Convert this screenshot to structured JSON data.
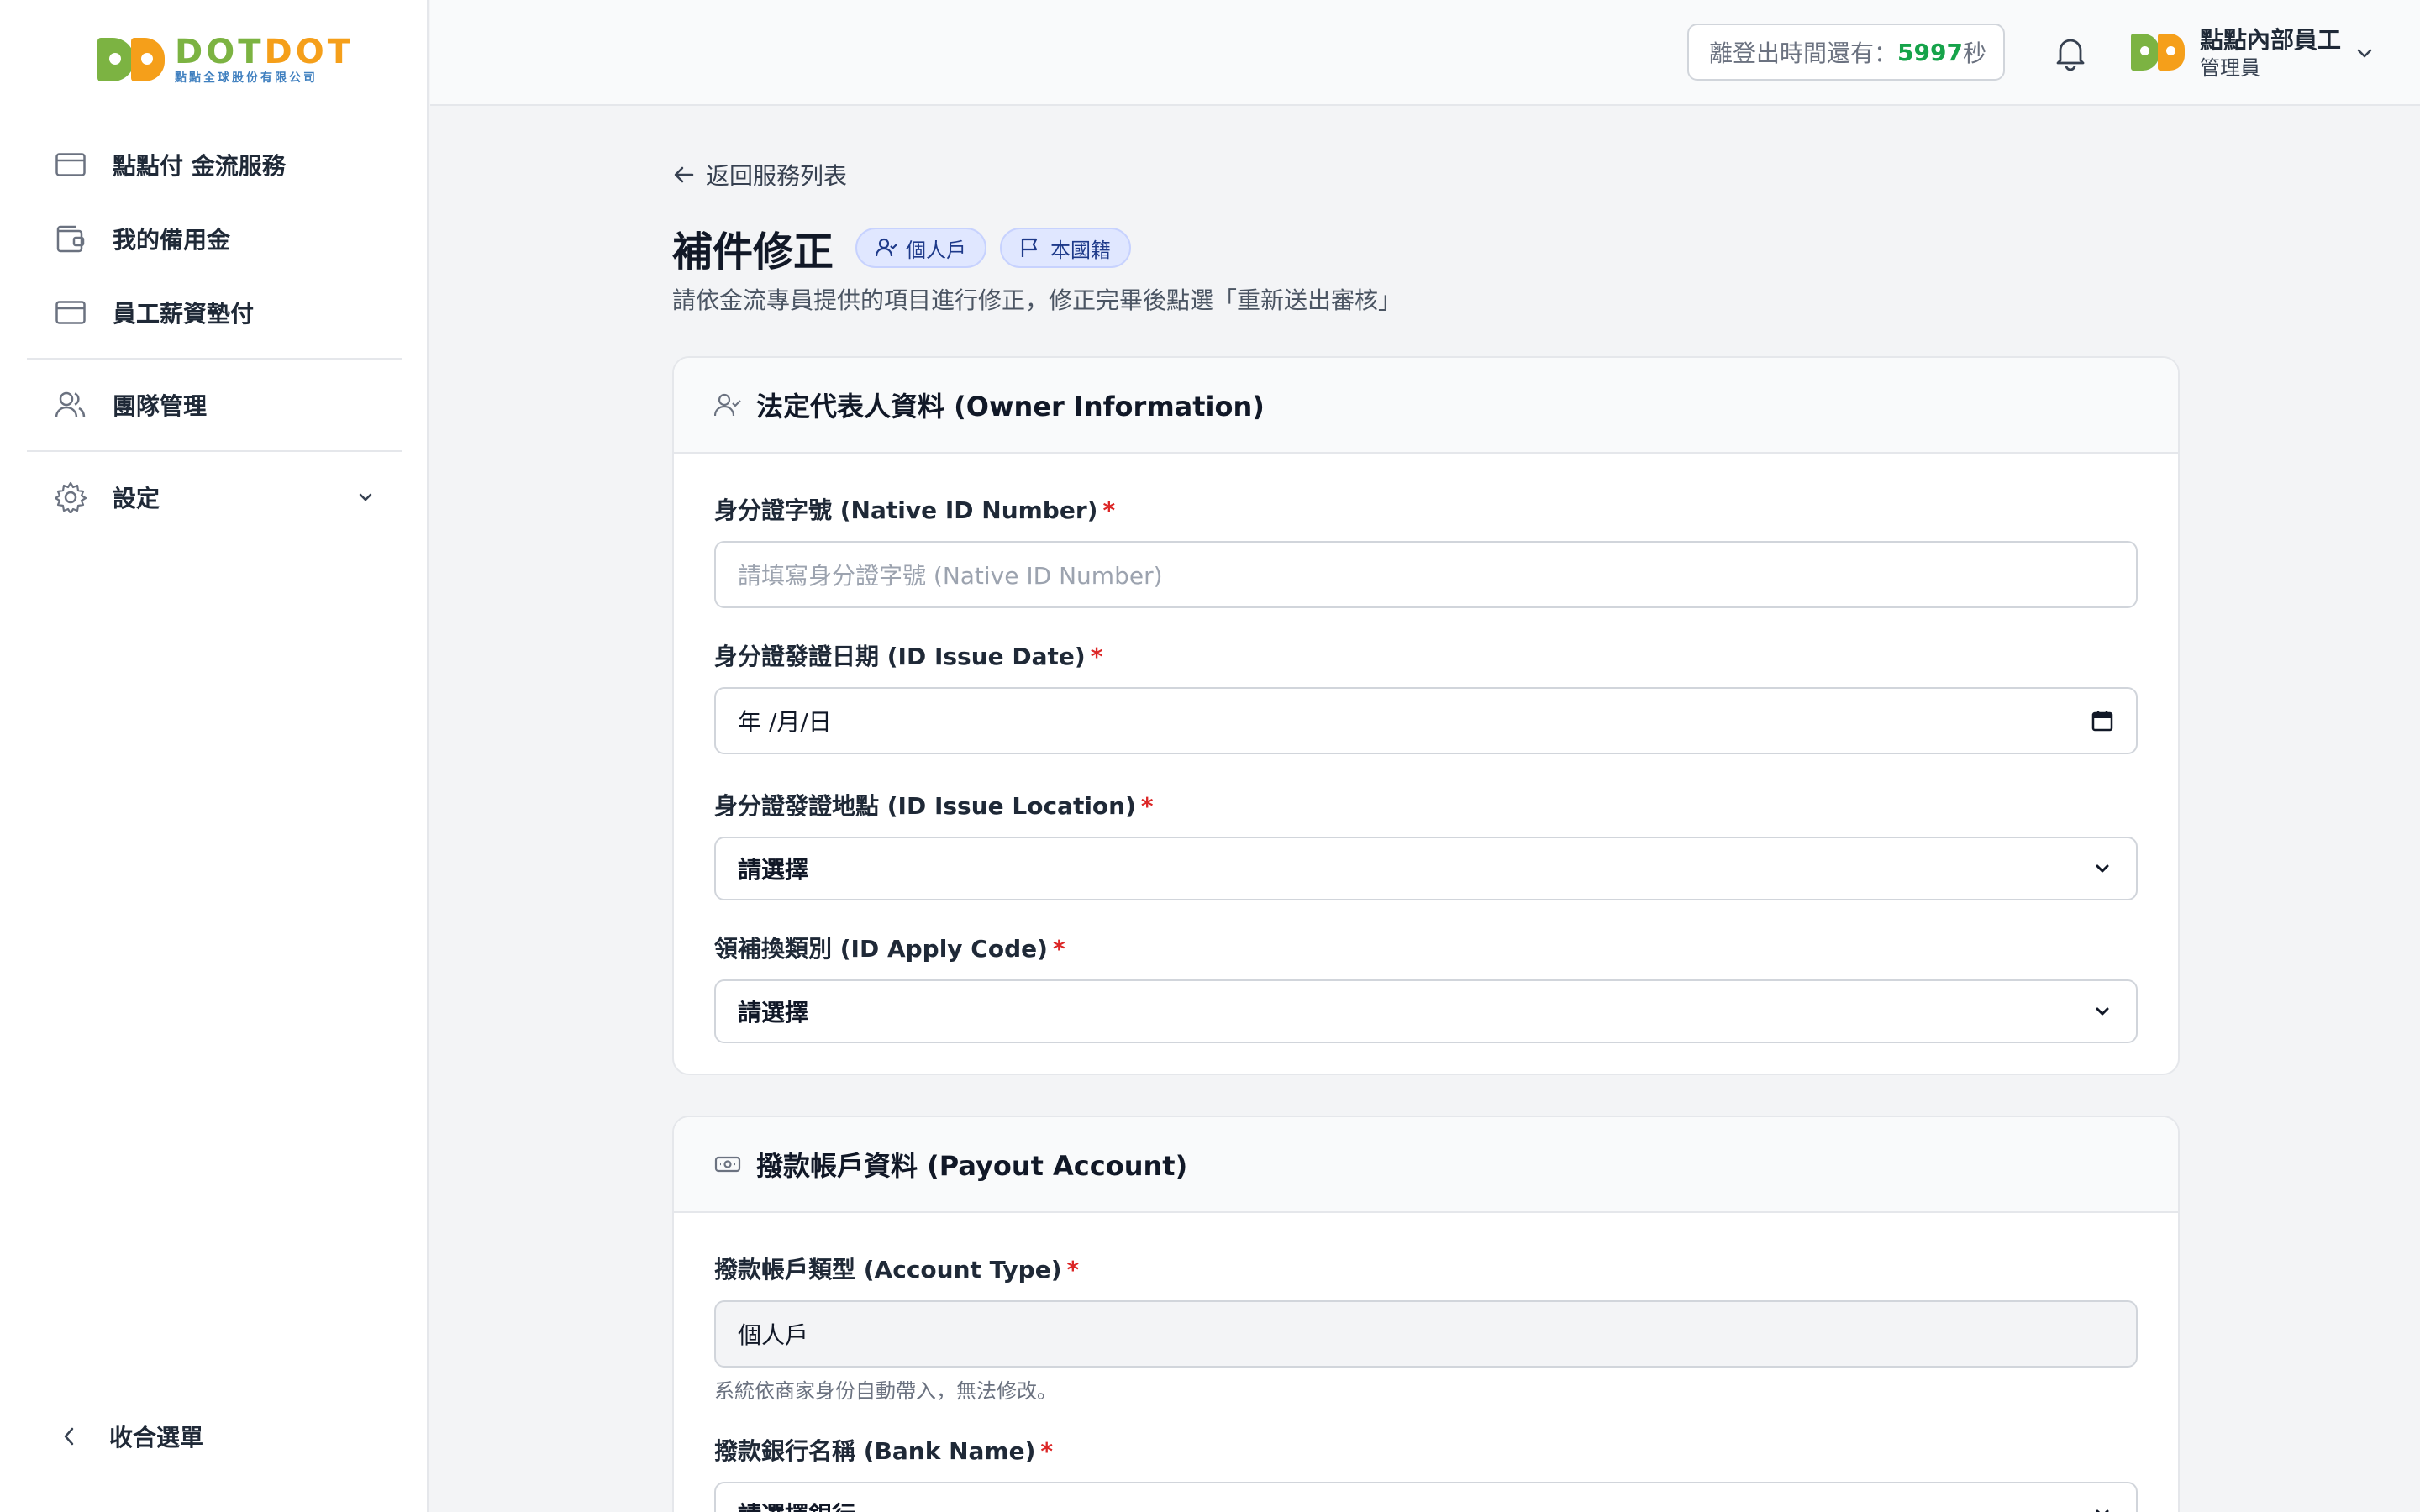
{
  "brand": {
    "name_part1": "DOT",
    "name_part2": "DOT",
    "subtitle": "點點全球股份有限公司"
  },
  "sidebar": {
    "items": [
      {
        "label": "點點付 金流服務",
        "icon": "credit-card-icon"
      },
      {
        "label": "我的備用金",
        "icon": "wallet-icon"
      },
      {
        "label": "員工薪資墊付",
        "icon": "credit-card-icon"
      },
      {
        "label": "團隊管理",
        "icon": "users-icon"
      },
      {
        "label": "設定",
        "icon": "gear-icon"
      }
    ],
    "collapse_label": "收合選單"
  },
  "topbar": {
    "timer_prefix": "離登出時間還有：",
    "timer_value": "5997",
    "timer_suffix": "秒",
    "user_name": "點點內部員工",
    "user_role": "管理員"
  },
  "page": {
    "back_label": "返回服務列表",
    "title": "補件修正",
    "badges": [
      "個人戶",
      "本國籍"
    ],
    "subtitle": "請依金流專員提供的項目進行修正，修正完畢後點選「重新送出審核」"
  },
  "owner_card": {
    "title": "法定代表人資料 (Owner Information)",
    "fields": {
      "native_id": {
        "label": "身分證字號 (Native ID Number)",
        "placeholder": "請填寫身分證字號 (Native ID Number)"
      },
      "issue_date": {
        "label": "身分證發證日期 (ID Issue Date)",
        "value": "年 /月/日"
      },
      "issue_location": {
        "label": "身分證發證地點 (ID Issue Location)",
        "value": "請選擇"
      },
      "apply_code": {
        "label": "領補換類別 (ID Apply Code)",
        "value": "請選擇"
      }
    }
  },
  "payout_card": {
    "title": "撥款帳戶資料 (Payout Account)",
    "fields": {
      "account_type": {
        "label": "撥款帳戶類型 (Account Type)",
        "value": "個人戶",
        "hint": "系統依商家身份自動帶入，無法修改。"
      },
      "bank_name": {
        "label": "撥款銀行名稱 (Bank Name)",
        "value": "請選擇銀行"
      }
    }
  },
  "colors": {
    "accent_green": "#7cb342",
    "accent_orange": "#f59f1a",
    "required_red": "#dc2626",
    "timer_green": "#16a34a"
  }
}
